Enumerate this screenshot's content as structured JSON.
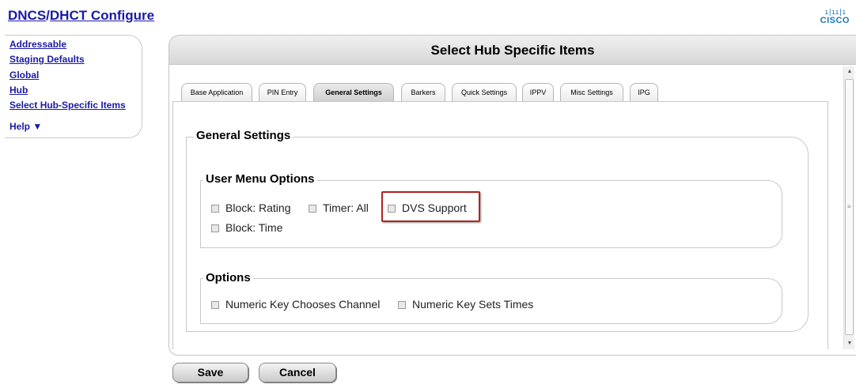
{
  "header": {
    "title_part1": "DNCS",
    "separator": "/",
    "title_part2": "DHCT Configure",
    "logo_bars": "ı|ıı|ı",
    "logo_text": "CISCO"
  },
  "nav": {
    "items": [
      {
        "label": "Addressable"
      },
      {
        "label": "Staging Defaults"
      },
      {
        "label": "Global"
      },
      {
        "label": "Hub"
      },
      {
        "label": "Select Hub-Specific Items"
      }
    ],
    "help_label": "Help ▼"
  },
  "main": {
    "title": "Select Hub Specific Items",
    "tabs": [
      {
        "label": "Base Application",
        "active": false
      },
      {
        "label": "PIN Entry",
        "active": false
      },
      {
        "label": "General Settings",
        "active": true
      },
      {
        "label": "Barkers",
        "active": false
      },
      {
        "label": "Quick Settings",
        "active": false
      },
      {
        "label": "IPPV",
        "active": false
      },
      {
        "label": "Misc Settings",
        "active": false
      },
      {
        "label": "IPG",
        "active": false
      }
    ],
    "general_settings_legend": "General Settings",
    "user_menu": {
      "legend": "User Menu Options",
      "options": [
        {
          "label": "Block: Rating",
          "checked": false
        },
        {
          "label": "Timer: All",
          "checked": false
        },
        {
          "label": "DVS Support",
          "checked": false
        },
        {
          "label": "Block: Time",
          "checked": false
        }
      ]
    },
    "options": {
      "legend": "Options",
      "items": [
        {
          "label": "Numeric Key Chooses Channel",
          "checked": false
        },
        {
          "label": "Numeric Key Sets Times",
          "checked": false
        }
      ]
    }
  },
  "buttons": {
    "save_label": "Save",
    "cancel_label": "Cancel"
  },
  "colors": {
    "link": "#1a1aa8",
    "highlight": "#b22222",
    "logo": "#1b75bb"
  }
}
